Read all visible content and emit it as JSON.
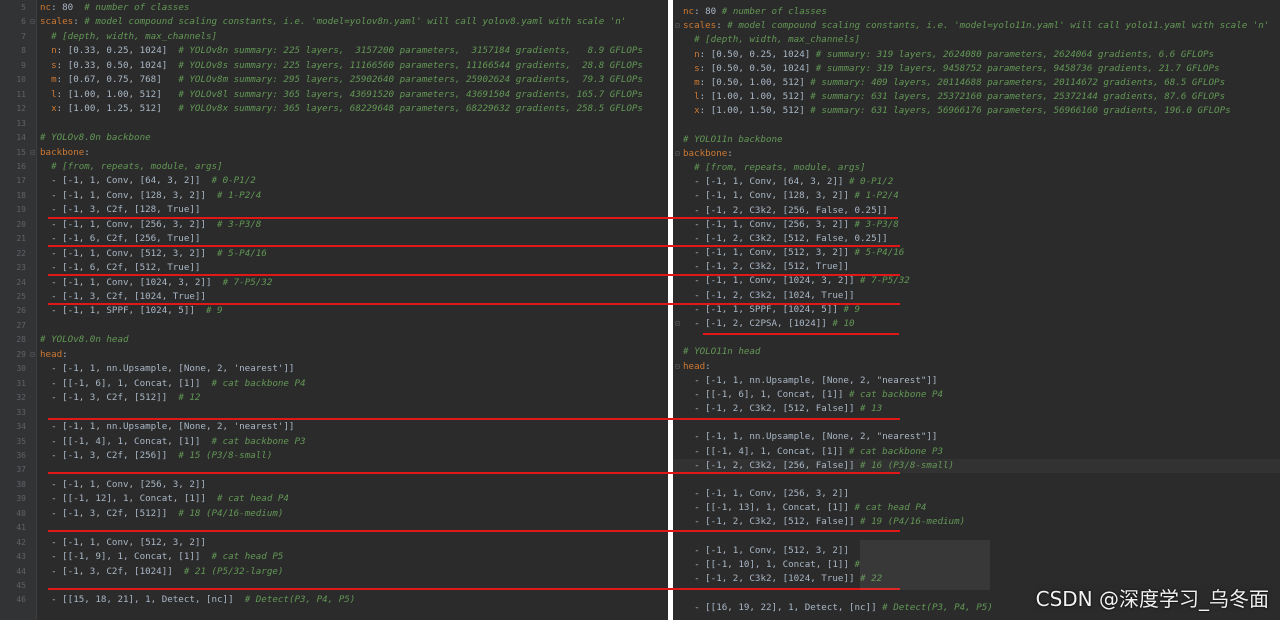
{
  "left_editor": {
    "lines": [
      {
        "ln": "5",
        "fold": false,
        "indent": 0,
        "key": "nc",
        "code": ": 80  ",
        "comment": "# number of classes"
      },
      {
        "ln": "6",
        "fold": true,
        "indent": 0,
        "key": "scales",
        "code": ": ",
        "comment": "# model compound scaling constants, i.e. 'model=yolov8n.yaml' will call yolov8.yaml with scale 'n'"
      },
      {
        "ln": "7",
        "fold": false,
        "indent": 2,
        "key": "",
        "code": "",
        "comment": "# [depth, width, max_channels]"
      },
      {
        "ln": "8",
        "fold": false,
        "indent": 2,
        "key": "n",
        "code": ": [0.33, 0.25, 1024]  ",
        "comment": "# YOLOv8n summary: 225 layers,  3157200 parameters,  3157184 gradients,   8.9 GFLOPs"
      },
      {
        "ln": "9",
        "fold": false,
        "indent": 2,
        "key": "s",
        "code": ": [0.33, 0.50, 1024]  ",
        "comment": "# YOLOv8s summary: 225 layers, 11166560 parameters, 11166544 gradients,  28.8 GFLOPs"
      },
      {
        "ln": "10",
        "fold": false,
        "indent": 2,
        "key": "m",
        "code": ": [0.67, 0.75, 768]   ",
        "comment": "# YOLOv8m summary: 295 layers, 25902640 parameters, 25902624 gradients,  79.3 GFLOPs"
      },
      {
        "ln": "11",
        "fold": false,
        "indent": 2,
        "key": "l",
        "code": ": [1.00, 1.00, 512]   ",
        "comment": "# YOLOv8l summary: 365 layers, 43691520 parameters, 43691504 gradients, 165.7 GFLOPs"
      },
      {
        "ln": "12",
        "fold": false,
        "indent": 2,
        "key": "x",
        "code": ": [1.00, 1.25, 512]   ",
        "comment": "# YOLOv8x summary: 365 layers, 68229648 parameters, 68229632 gradients, 258.5 GFLOPs"
      },
      {
        "ln": "13",
        "fold": false,
        "indent": 0,
        "key": "",
        "code": "",
        "comment": ""
      },
      {
        "ln": "14",
        "fold": false,
        "indent": 0,
        "key": "",
        "code": "",
        "comment": "# YOLOv8.0n backbone"
      },
      {
        "ln": "15",
        "fold": true,
        "indent": 0,
        "key": "backbone",
        "code": ":",
        "comment": ""
      },
      {
        "ln": "16",
        "fold": false,
        "indent": 2,
        "key": "",
        "code": "",
        "comment": "# [from, repeats, module, args]"
      },
      {
        "ln": "17",
        "fold": false,
        "indent": 2,
        "key": "",
        "code": "- [-1, 1, Conv, [64, 3, 2]]  ",
        "comment": "# 0-P1/2"
      },
      {
        "ln": "18",
        "fold": false,
        "indent": 2,
        "key": "",
        "code": "- [-1, 1, Conv, [128, 3, 2]]  ",
        "comment": "# 1-P2/4"
      },
      {
        "ln": "19",
        "fold": false,
        "indent": 2,
        "key": "",
        "code": "- [-1, 3, C2f, [128, True]]",
        "comment": ""
      },
      {
        "ln": "20",
        "fold": false,
        "indent": 2,
        "key": "",
        "code": "- [-1, 1, Conv, [256, 3, 2]]  ",
        "comment": "# 3-P3/8"
      },
      {
        "ln": "21",
        "fold": false,
        "indent": 2,
        "key": "",
        "code": "- [-1, 6, C2f, [256, True]]",
        "comment": ""
      },
      {
        "ln": "22",
        "fold": false,
        "indent": 2,
        "key": "",
        "code": "- [-1, 1, Conv, [512, 3, 2]]  ",
        "comment": "# 5-P4/16"
      },
      {
        "ln": "23",
        "fold": false,
        "indent": 2,
        "key": "",
        "code": "- [-1, 6, C2f, [512, True]]",
        "comment": ""
      },
      {
        "ln": "24",
        "fold": false,
        "indent": 2,
        "key": "",
        "code": "- [-1, 1, Conv, [1024, 3, 2]]  ",
        "comment": "# 7-P5/32"
      },
      {
        "ln": "25",
        "fold": false,
        "indent": 2,
        "key": "",
        "code": "- [-1, 3, C2f, [1024, True]]",
        "comment": ""
      },
      {
        "ln": "26",
        "fold": false,
        "indent": 2,
        "key": "",
        "code": "- [-1, 1, SPPF, [1024, 5]]  ",
        "comment": "# 9"
      },
      {
        "ln": "27",
        "fold": false,
        "indent": 0,
        "key": "",
        "code": "",
        "comment": ""
      },
      {
        "ln": "28",
        "fold": false,
        "indent": 0,
        "key": "",
        "code": "",
        "comment": "# YOLOv8.0n head"
      },
      {
        "ln": "29",
        "fold": true,
        "indent": 0,
        "key": "head",
        "code": ":",
        "comment": ""
      },
      {
        "ln": "30",
        "fold": false,
        "indent": 2,
        "key": "",
        "code": "- [-1, 1, nn.Upsample, [None, 2, 'nearest']]",
        "comment": ""
      },
      {
        "ln": "31",
        "fold": false,
        "indent": 2,
        "key": "",
        "code": "- [[-1, 6], 1, Concat, [1]]  ",
        "comment": "# cat backbone P4"
      },
      {
        "ln": "32",
        "fold": false,
        "indent": 2,
        "key": "",
        "code": "- [-1, 3, C2f, [512]]  ",
        "comment": "# 12"
      },
      {
        "ln": "33",
        "fold": false,
        "indent": 0,
        "key": "",
        "code": "",
        "comment": ""
      },
      {
        "ln": "34",
        "fold": false,
        "indent": 2,
        "key": "",
        "code": "- [-1, 1, nn.Upsample, [None, 2, 'nearest']]",
        "comment": ""
      },
      {
        "ln": "35",
        "fold": false,
        "indent": 2,
        "key": "",
        "code": "- [[-1, 4], 1, Concat, [1]]  ",
        "comment": "# cat backbone P3"
      },
      {
        "ln": "36",
        "fold": false,
        "indent": 2,
        "key": "",
        "code": "- [-1, 3, C2f, [256]]  ",
        "comment": "# 15 (P3/8-small)"
      },
      {
        "ln": "37",
        "fold": false,
        "indent": 0,
        "key": "",
        "code": "",
        "comment": ""
      },
      {
        "ln": "38",
        "fold": false,
        "indent": 2,
        "key": "",
        "code": "- [-1, 1, Conv, [256, 3, 2]]",
        "comment": ""
      },
      {
        "ln": "39",
        "fold": false,
        "indent": 2,
        "key": "",
        "code": "- [[-1, 12], 1, Concat, [1]]  ",
        "comment": "# cat head P4"
      },
      {
        "ln": "40",
        "fold": false,
        "indent": 2,
        "key": "",
        "code": "- [-1, 3, C2f, [512]]  ",
        "comment": "# 18 (P4/16-medium)"
      },
      {
        "ln": "41",
        "fold": false,
        "indent": 0,
        "key": "",
        "code": "",
        "comment": ""
      },
      {
        "ln": "42",
        "fold": false,
        "indent": 2,
        "key": "",
        "code": "- [-1, 1, Conv, [512, 3, 2]]",
        "comment": ""
      },
      {
        "ln": "43",
        "fold": false,
        "indent": 2,
        "key": "",
        "code": "- [[-1, 9], 1, Concat, [1]]  ",
        "comment": "# cat head P5"
      },
      {
        "ln": "44",
        "fold": false,
        "indent": 2,
        "key": "",
        "code": "- [-1, 3, C2f, [1024]]  ",
        "comment": "# 21 (P5/32-large)"
      },
      {
        "ln": "45",
        "fold": false,
        "indent": 0,
        "key": "",
        "code": "",
        "comment": ""
      },
      {
        "ln": "46",
        "fold": false,
        "indent": 2,
        "key": "",
        "code": "- [[15, 18, 21], 1, Detect, [nc]]  ",
        "comment": "# Detect(P3, P4, P5)"
      }
    ]
  },
  "right_editor": {
    "lines": [
      {
        "fold": false,
        "indent": 0,
        "key": "nc",
        "code": ": 80 ",
        "comment": "# number of classes"
      },
      {
        "fold": true,
        "indent": 0,
        "key": "scales",
        "code": ": ",
        "comment": "# model compound scaling constants, i.e. 'model=yolo11n.yaml' will call yolo11.yaml with scale 'n'"
      },
      {
        "fold": false,
        "indent": 2,
        "key": "",
        "code": "",
        "comment": "# [depth, width, max_channels]"
      },
      {
        "fold": false,
        "indent": 2,
        "key": "n",
        "code": ": [0.50, 0.25, 1024] ",
        "comment": "# summary: 319 layers, 2624080 parameters, 2624064 gradients, 6.6 GFLOPs"
      },
      {
        "fold": false,
        "indent": 2,
        "key": "s",
        "code": ": [0.50, 0.50, 1024] ",
        "comment": "# summary: 319 layers, 9458752 parameters, 9458736 gradients, 21.7 GFLOPs"
      },
      {
        "fold": false,
        "indent": 2,
        "key": "m",
        "code": ": [0.50, 1.00, 512] ",
        "comment": "# summary: 409 layers, 20114688 parameters, 20114672 gradients, 68.5 GFLOPs"
      },
      {
        "fold": false,
        "indent": 2,
        "key": "l",
        "code": ": [1.00, 1.00, 512] ",
        "comment": "# summary: 631 layers, 25372160 parameters, 25372144 gradients, 87.6 GFLOPs"
      },
      {
        "fold": false,
        "indent": 2,
        "key": "x",
        "code": ": [1.00, 1.50, 512] ",
        "comment": "# summary: 631 layers, 56966176 parameters, 56966160 gradients, 196.0 GFLOPs"
      },
      {
        "fold": false,
        "indent": 0,
        "key": "",
        "code": "",
        "comment": ""
      },
      {
        "fold": false,
        "indent": 0,
        "key": "",
        "code": "",
        "comment": "# YOLO11n backbone"
      },
      {
        "fold": true,
        "indent": 0,
        "key": "backbone",
        "code": ":",
        "comment": ""
      },
      {
        "fold": false,
        "indent": 2,
        "key": "",
        "code": "",
        "comment": "# [from, repeats, module, args]"
      },
      {
        "fold": false,
        "indent": 2,
        "key": "",
        "code": "- [-1, 1, Conv, [64, 3, 2]] ",
        "comment": "# 0-P1/2"
      },
      {
        "fold": false,
        "indent": 2,
        "key": "",
        "code": "- [-1, 1, Conv, [128, 3, 2]] ",
        "comment": "# 1-P2/4"
      },
      {
        "fold": false,
        "indent": 2,
        "key": "",
        "code": "- [-1, 2, C3k2, [256, False, 0.25]]",
        "comment": ""
      },
      {
        "fold": false,
        "indent": 2,
        "key": "",
        "code": "- [-1, 1, Conv, [256, 3, 2]] ",
        "comment": "# 3-P3/8"
      },
      {
        "fold": false,
        "indent": 2,
        "key": "",
        "code": "- [-1, 2, C3k2, [512, False, 0.25]]",
        "comment": ""
      },
      {
        "fold": false,
        "indent": 2,
        "key": "",
        "code": "- [-1, 1, Conv, [512, 3, 2]] ",
        "comment": "# 5-P4/16"
      },
      {
        "fold": false,
        "indent": 2,
        "key": "",
        "code": "- [-1, 2, C3k2, [512, True]]",
        "comment": ""
      },
      {
        "fold": false,
        "indent": 2,
        "key": "",
        "code": "- [-1, 1, Conv, [1024, 3, 2]] ",
        "comment": "# 7-P5/32"
      },
      {
        "fold": false,
        "indent": 2,
        "key": "",
        "code": "- [-1, 2, C3k2, [1024, True]]",
        "comment": ""
      },
      {
        "fold": false,
        "indent": 2,
        "key": "",
        "code": "- [-1, 1, SPPF, [1024, 5]] ",
        "comment": "# 9"
      },
      {
        "fold": true,
        "indent": 2,
        "key": "",
        "code": "- [-1, 2, C2PSA, [1024]] ",
        "comment": "# 10"
      },
      {
        "fold": false,
        "indent": 0,
        "key": "",
        "code": "",
        "comment": ""
      },
      {
        "fold": false,
        "indent": 0,
        "key": "",
        "code": "",
        "comment": "# YOLO11n head"
      },
      {
        "fold": true,
        "indent": 0,
        "key": "head",
        "code": ":",
        "comment": ""
      },
      {
        "fold": false,
        "indent": 2,
        "key": "",
        "code": "- [-1, 1, nn.Upsample, [None, 2, \"nearest\"]]",
        "comment": ""
      },
      {
        "fold": false,
        "indent": 2,
        "key": "",
        "code": "- [[-1, 6], 1, Concat, [1]] ",
        "comment": "# cat backbone P4"
      },
      {
        "fold": false,
        "indent": 2,
        "key": "",
        "code": "- [-1, 2, C3k2, [512, False]] ",
        "comment": "# 13"
      },
      {
        "fold": false,
        "indent": 0,
        "key": "",
        "code": "",
        "comment": ""
      },
      {
        "fold": false,
        "indent": 2,
        "key": "",
        "code": "- [-1, 1, nn.Upsample, [None, 2, \"nearest\"]]",
        "comment": ""
      },
      {
        "fold": false,
        "indent": 2,
        "key": "",
        "code": "- [[-1, 4], 1, Concat, [1]] ",
        "comment": "# cat backbone P3"
      },
      {
        "fold": false,
        "indent": 2,
        "key": "",
        "code": "- [-1, 2, C3k2, [256, False]] ",
        "comment": "# 16 (P3/8-small)",
        "highlight": true
      },
      {
        "fold": false,
        "indent": 0,
        "key": "",
        "code": "",
        "comment": ""
      },
      {
        "fold": false,
        "indent": 2,
        "key": "",
        "code": "- [-1, 1, Conv, [256, 3, 2]]",
        "comment": ""
      },
      {
        "fold": false,
        "indent": 2,
        "key": "",
        "code": "- [[-1, 13], 1, Concat, [1]] ",
        "comment": "# cat head P4"
      },
      {
        "fold": false,
        "indent": 2,
        "key": "",
        "code": "- [-1, 2, C3k2, [512, False]] ",
        "comment": "# 19 (P4/16-medium)"
      },
      {
        "fold": false,
        "indent": 0,
        "key": "",
        "code": "",
        "comment": ""
      },
      {
        "fold": false,
        "indent": 2,
        "key": "",
        "code": "- [-1, 1, Conv, [512, 3, 2]]",
        "comment": ""
      },
      {
        "fold": false,
        "indent": 2,
        "key": "",
        "code": "- [[-1, 10], 1, Concat, [1]] ",
        "comment": "# "
      },
      {
        "fold": false,
        "indent": 2,
        "key": "",
        "code": "- [-1, 2, C3k2, [1024, True]] ",
        "comment": "# 22"
      },
      {
        "fold": false,
        "indent": 0,
        "key": "",
        "code": "",
        "comment": ""
      },
      {
        "fold": false,
        "indent": 2,
        "key": "",
        "code": "- [[16, 19, 22], 1, Detect, [nc]] ",
        "comment": "# Detect(P3, P4, P5)"
      }
    ]
  },
  "watermark": "CSDN @深度学习_乌冬面",
  "colors": {
    "background": "#2b2b2b",
    "comment": "#629755",
    "key": "#cc7832",
    "code": "#a9b7c6",
    "line_number": "#606366",
    "annotation_line": "#e01818"
  }
}
